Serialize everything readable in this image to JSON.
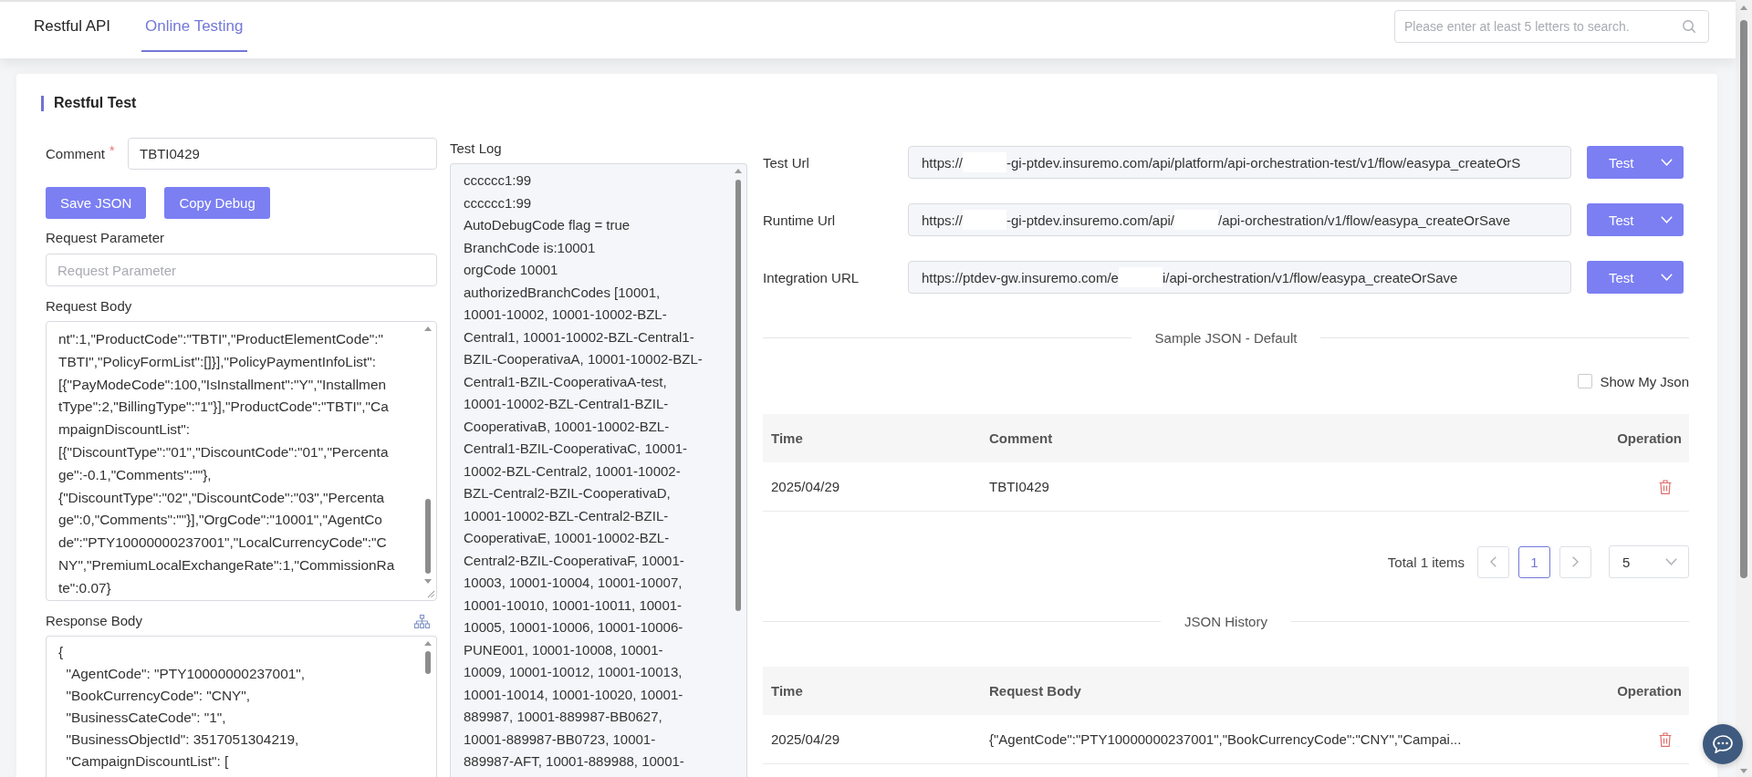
{
  "header": {
    "tabs": [
      {
        "label": "Restful API",
        "selected": false
      },
      {
        "label": "Online Testing",
        "selected": true
      }
    ],
    "search": {
      "placeholder": "Please enter at least 5 letters to search."
    }
  },
  "section": {
    "title": "Restful Test"
  },
  "form": {
    "comment": {
      "label": "Comment",
      "required_mark": "*",
      "value": "TBTI0429"
    },
    "buttons": [
      "Save JSON",
      "Copy Debug"
    ],
    "request_parameter": {
      "label": "Request Parameter",
      "placeholder": "Request Parameter"
    },
    "request_body": {
      "label": "Request Body",
      "lines": [
        "nt\":1,\"ProductCode\":\"TBTI\",\"ProductElementCode\":\"",
        "TBTI\",\"PolicyFormList\":[]}],\"PolicyPaymentInfoList\":",
        "[{\"PayModeCode\":100,\"IsInstallment\":\"Y\",\"Installmen",
        "tType\":2,\"BillingType\":\"1\"}],\"ProductCode\":\"TBTI\",\"Ca",
        "mpaignDiscountList\":",
        "[{\"DiscountType\":\"01\",\"DiscountCode\":\"01\",\"Percenta",
        "ge\":-0.1,\"Comments\":\"\"},",
        "{\"DiscountType\":\"02\",\"DiscountCode\":\"03\",\"Percenta",
        "ge\":0,\"Comments\":\"\"}],\"OrgCode\":\"10001\",\"AgentCo",
        "de\":\"PTY10000000237001\",\"LocalCurrencyCode\":\"C",
        "NY\",\"PremiumLocalExchangeRate\":1,\"CommissionRa",
        "te\":0.07}"
      ]
    },
    "response_body": {
      "label": "Response Body",
      "lines": [
        "{",
        "  \"AgentCode\": \"PTY10000000237001\",",
        "  \"BookCurrencyCode\": \"CNY\",",
        "  \"BusinessCateCode\": \"1\",",
        "  \"BusinessObjectId\": 3517051304219,",
        "  \"CampaignDiscountList\": ["
      ]
    }
  },
  "test_log": {
    "label": "Test Log",
    "entries": [
      "cccccc1:99",
      "cccccc1:99",
      "AutoDebugCode flag = true",
      "BranchCode is:10001",
      "orgCode 10001",
      "authorizedBranchCodes [10001, 10001-10002, 10001-10002-BZL-Central1, 10001-10002-BZL-Central1-BZIL-CooperativaA, 10001-10002-BZL-Central1-BZIL-CooperativaA-test, 10001-10002-BZL-Central1-BZIL-CooperativaB, 10001-10002-BZL-Central1-BZIL-CooperativaC, 10001-10002-BZL-Central2, 10001-10002-BZL-Central2-BZIL-CooperativaD, 10001-10002-BZL-Central2-BZIL-CooperativaE, 10001-10002-BZL-Central2-BZIL-CooperativaF, 10001-10003, 10001-10004, 10001-10007, 10001-10010, 10001-10011, 10001-10005, 10001-10006, 10001-10006-PUNE001, 10001-10008, 10001-10009, 10001-10012, 10001-10013, 10001-10014, 10001-10020, 10001-889987, 10001-889987-BB0627, 10001-889987-BB0723, 10001-889987-AFT, 10001-889988, 10001-"
    ]
  },
  "urls": [
    {
      "label": "Test Url",
      "value_parts": [
        "https://",
        "-gi-ptdev.insuremo.com/api/platform/api-orchestration-test/v1/flow/easypa_createOrS"
      ],
      "button": "Test"
    },
    {
      "label": "Runtime Url",
      "value_parts": [
        "https://",
        "-gi-ptdev.insuremo.com/api/",
        "/api-orchestration/v1/flow/easypa_createOrSave"
      ],
      "button": "Test"
    },
    {
      "label": "Integration URL",
      "value_parts": [
        "https://ptdev-gw.insuremo.com/e",
        "i/api-orchestration/v1/flow/easypa_createOrSave"
      ],
      "button": "Test"
    }
  ],
  "sample_json": {
    "divider": "Sample JSON - Default",
    "show_my_json": {
      "label": "Show My Json",
      "checked": false
    },
    "table": {
      "columns": [
        "Time",
        "Comment",
        "Operation"
      ],
      "rows": [
        [
          "2025/04/29",
          "TBTI0429"
        ]
      ]
    },
    "pagination": {
      "total": "Total 1 items",
      "pages": [
        {
          "label": "1",
          "selected": true
        }
      ],
      "page_size": "5"
    }
  },
  "json_history": {
    "divider": "JSON History",
    "table": {
      "columns": [
        "Time",
        "Request Body",
        "Operation"
      ],
      "rows": [
        [
          "2025/04/29",
          "{\"AgentCode\":\"PTY10000000237001\",\"BookCurrencyCode\":\"CNY\",\"Campai..."
        ]
      ]
    }
  }
}
